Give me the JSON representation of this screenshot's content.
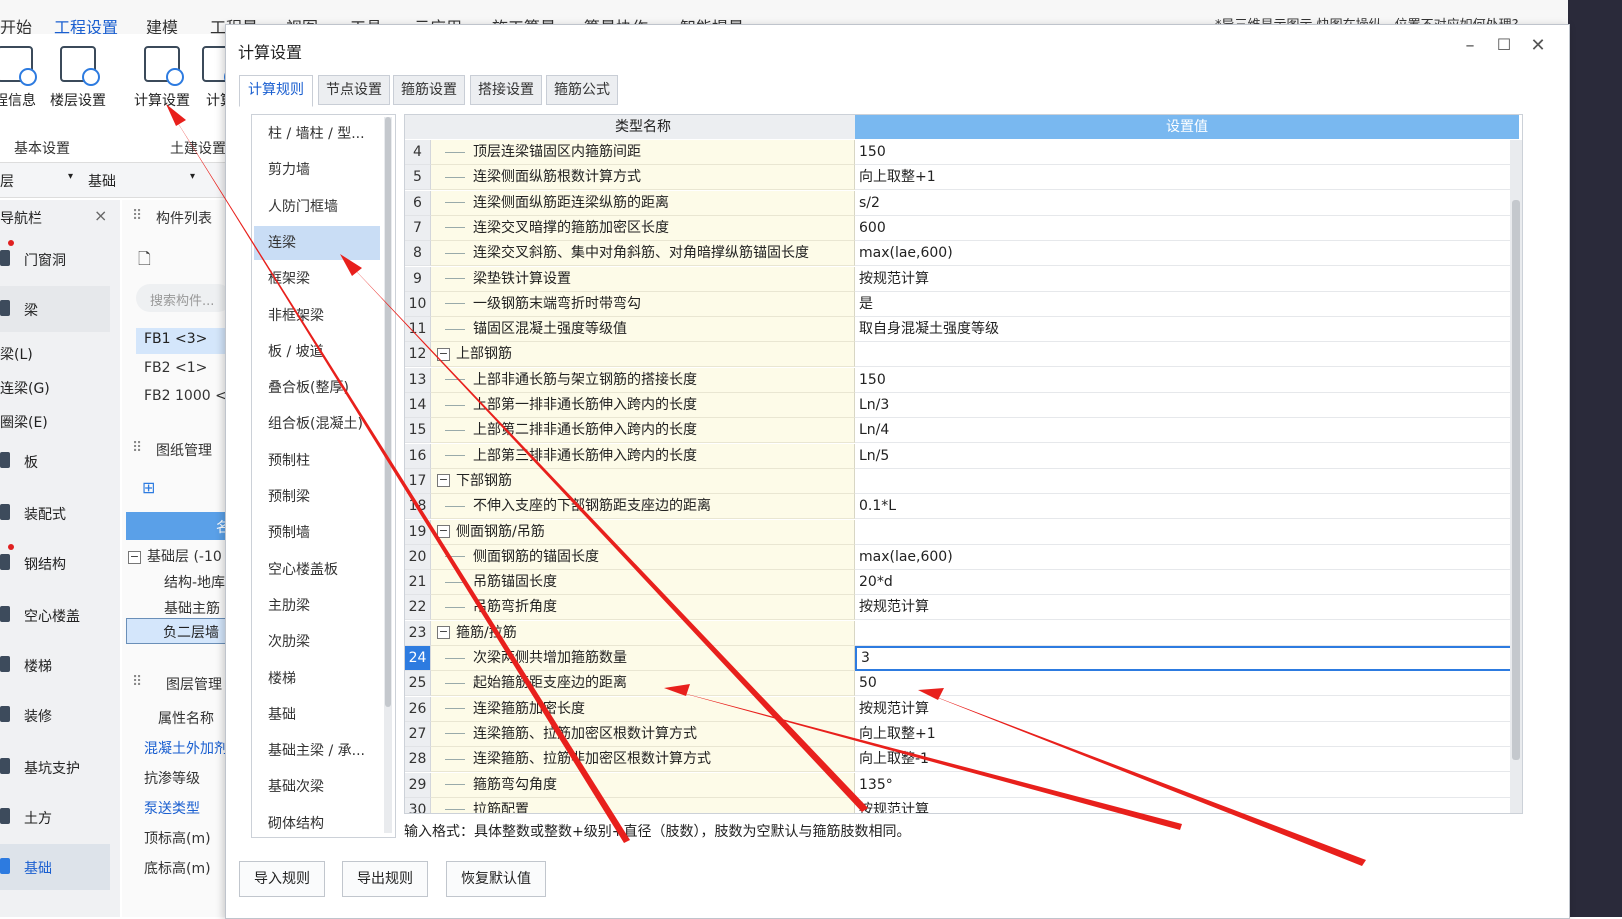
{
  "menu": {
    "items": [
      "开始",
      "工程设置",
      "建模",
      "工程量",
      "视图",
      "工具",
      "云应用",
      "施工算量",
      "算量协作",
      "智能提量"
    ],
    "active_index": 1,
    "notice": "*导三维显示图示 快图在操纵，位置不对应如何处理?"
  },
  "ribbon": {
    "buttons": [
      "程信息",
      "楼层设置",
      "计算设置",
      "计算"
    ],
    "groups": [
      "基本设置",
      "土建设置"
    ]
  },
  "floor_select": {
    "left": "层",
    "right": "基础"
  },
  "navbar": {
    "title": "导航栏",
    "close": "×",
    "items": [
      "门窗洞",
      "梁",
      "梁(L)",
      "连梁(G)",
      "圈梁(E)",
      "板",
      "装配式",
      "钢结构",
      "空心楼盖",
      "楼梯",
      "装修",
      "基坑支护",
      "土方",
      "基础"
    ]
  },
  "component_list": {
    "title": "构件列表",
    "search_placeholder": "搜索构件...",
    "rows": [
      "FB1 <3>",
      "FB2 <1>",
      "FB2  1000 <"
    ]
  },
  "drawing_mgmt": {
    "title": "图纸管理",
    "column": "名",
    "tree": [
      "基础层 (-10",
      "结构-地库",
      "基础主筋",
      "负二层墙"
    ]
  },
  "layer_mgmt": {
    "title": "图层管理",
    "prop_header": "属性名称",
    "props": [
      "混凝土外加剂",
      "抗渗等级",
      "泵送类型",
      "顶标高(m)",
      "底标高(m)"
    ]
  },
  "dialog": {
    "title": "计算设置",
    "tabs": [
      "计算规则",
      "节点设置",
      "箍筋设置",
      "搭接设置",
      "箍筋公式"
    ],
    "active_tab": 0,
    "categories": [
      "柱 / 墙柱 / 型...",
      "剪力墙",
      "人防门框墙",
      "连梁",
      "框架梁",
      "非框架梁",
      "板 / 坡道",
      "叠合板(整厚)",
      "组合板(混凝土)",
      "预制柱",
      "预制梁",
      "预制墙",
      "空心楼盖板",
      "主肋梁",
      "次肋梁",
      "楼梯",
      "基础",
      "基础主梁 / 承...",
      "基础次梁",
      "砌体结构"
    ],
    "selected_category": 3,
    "grid_header": {
      "name": "类型名称",
      "value": "设置值"
    },
    "rows": [
      {
        "num": "4",
        "name": "顶层连梁锚固区内箍筋间距",
        "value": "150",
        "group": false
      },
      {
        "num": "5",
        "name": "连梁侧面纵筋根数计算方式",
        "value": "向上取整+1",
        "group": false
      },
      {
        "num": "6",
        "name": "连梁侧面纵筋距连梁纵筋的距离",
        "value": "s/2",
        "group": false
      },
      {
        "num": "7",
        "name": "连梁交叉暗撑的箍筋加密区长度",
        "value": "600",
        "group": false
      },
      {
        "num": "8",
        "name": "连梁交叉斜筋、集中对角斜筋、对角暗撑纵筋锚固长度",
        "value": "max(lae,600)",
        "group": false
      },
      {
        "num": "9",
        "name": "梁垫铁计算设置",
        "value": "按规范计算",
        "group": false
      },
      {
        "num": "10",
        "name": "一级钢筋末端弯折时带弯勾",
        "value": "是",
        "group": false
      },
      {
        "num": "11",
        "name": "锚固区混凝土强度等级值",
        "value": "取自身混凝土强度等级",
        "group": false
      },
      {
        "num": "12",
        "name": "上部钢筋",
        "value": "",
        "group": true
      },
      {
        "num": "13",
        "name": "上部非通长筋与架立钢筋的搭接长度",
        "value": "150",
        "group": false
      },
      {
        "num": "14",
        "name": "上部第一排非通长筋伸入跨内的长度",
        "value": "Ln/3",
        "group": false
      },
      {
        "num": "15",
        "name": "上部第二排非通长筋伸入跨内的长度",
        "value": "Ln/4",
        "group": false
      },
      {
        "num": "16",
        "name": "上部第三排非通长筋伸入跨内的长度",
        "value": "Ln/5",
        "group": false
      },
      {
        "num": "17",
        "name": "下部钢筋",
        "value": "",
        "group": true
      },
      {
        "num": "18",
        "name": "不伸入支座的下部钢筋距支座边的距离",
        "value": "0.1*L",
        "group": false
      },
      {
        "num": "19",
        "name": "侧面钢筋/吊筋",
        "value": "",
        "group": true
      },
      {
        "num": "20",
        "name": "侧面钢筋的锚固长度",
        "value": "max(lae,600)",
        "group": false
      },
      {
        "num": "21",
        "name": "吊筋锚固长度",
        "value": "20*d",
        "group": false
      },
      {
        "num": "22",
        "name": "吊筋弯折角度",
        "value": "按规范计算",
        "group": false
      },
      {
        "num": "23",
        "name": "箍筋/拉筋",
        "value": "",
        "group": true
      },
      {
        "num": "24",
        "name": "次梁两侧共增加箍筋数量",
        "value": "3",
        "group": false
      },
      {
        "num": "25",
        "name": "起始箍筋距支座边的距离",
        "value": "50",
        "group": false
      },
      {
        "num": "26",
        "name": "连梁箍筋加密长度",
        "value": "按规范计算",
        "group": false
      },
      {
        "num": "27",
        "name": "连梁箍筋、拉筋加密区根数计算方式",
        "value": "向上取整+1",
        "group": false
      },
      {
        "num": "28",
        "name": "连梁箍筋、拉筋非加密区根数计算方式",
        "value": "向上取整-1",
        "group": false
      },
      {
        "num": "29",
        "name": "箍筋弯勾角度",
        "value": "135°",
        "group": false
      },
      {
        "num": "30",
        "name": "拉筋配置",
        "value": "按规范计算",
        "group": false
      }
    ],
    "selected_row": "24",
    "hint": "输入格式：具体整数或整数+级别+直径（肢数），肢数为空默认与箍筋肢数相同。",
    "buttons": [
      "导入规则",
      "导出规则",
      "恢复默认值"
    ]
  },
  "colors": {
    "accent": "#2d7be0",
    "arrow": "#e8201c",
    "name_bg": "#fdfbe8",
    "header_value_bg": "#79b8f0"
  }
}
